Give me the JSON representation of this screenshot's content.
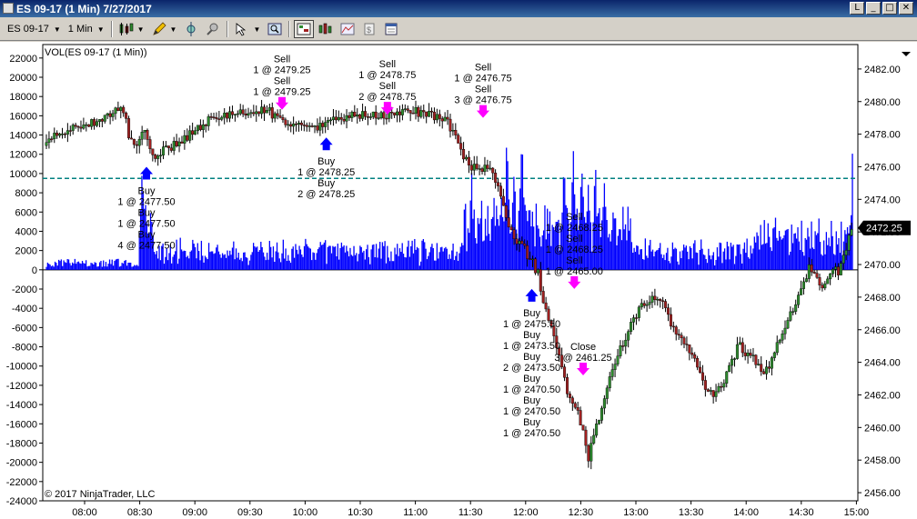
{
  "window": {
    "title": "ES 09-17 (1 Min)  7/27/2017",
    "buttons": [
      "L",
      "_",
      "□",
      "✕"
    ]
  },
  "toolbar": {
    "instrument": "ES 09-17",
    "interval": "1 Min",
    "icons": [
      "candlestick-icon",
      "pencil-icon",
      "crosshair-icon",
      "magnet-icon",
      "pointer-icon",
      "zoom-icon",
      "data-box-icon",
      "bar-style-icon",
      "line-chart-icon",
      "properties-icon",
      "window-icon"
    ]
  },
  "chart": {
    "indicator_label": "VOL(ES 09-17 (1 Min))",
    "copyright": "© 2017 NinjaTrader, LLC",
    "last_price_label": "2472.25",
    "colors": {
      "volume": "#0000ff",
      "up": "#2e8b2e",
      "down": "#a02020",
      "sell": "#ff00ff",
      "buy": "#0000ff",
      "zero_line": "#000000",
      "level_line": "#008080"
    }
  },
  "chart_data": {
    "type": "candlestick",
    "x_ticks": [
      "08:00",
      "08:30",
      "09:00",
      "09:30",
      "10:00",
      "10:30",
      "11:00",
      "11:30",
      "12:00",
      "12:30",
      "13:00",
      "13:30",
      "14:00",
      "14:30",
      "15:00"
    ],
    "price_ticks": [
      "2482.00",
      "2480.00",
      "2478.00",
      "2476.00",
      "2474.00",
      "2472.00",
      "2470.00",
      "2468.00",
      "2466.00",
      "2464.00",
      "2462.00",
      "2460.00",
      "2458.00",
      "2456.00"
    ],
    "volume_ticks": [
      "22000",
      "20000",
      "18000",
      "16000",
      "14000",
      "12000",
      "10000",
      "8000",
      "6000",
      "4000",
      "2000",
      "0",
      "-2000",
      "-4000",
      "-6000",
      "-8000",
      "-10000",
      "-12000",
      "-14000",
      "-16000",
      "-18000",
      "-20000",
      "-22000",
      "-24000"
    ],
    "price_range": [
      2455.5,
      2483.5
    ],
    "volume_range": [
      -24000,
      23400
    ],
    "price_path": [
      [
        0,
        2477.3
      ],
      [
        8,
        2477.9
      ],
      [
        20,
        2478.1
      ],
      [
        40,
        2478.5
      ],
      [
        60,
        2478.9
      ],
      [
        80,
        2479.4
      ],
      [
        88,
        2479.6
      ],
      [
        92,
        2477.8
      ],
      [
        100,
        2477.5
      ],
      [
        112,
        2478.0
      ],
      [
        118,
        2476.6
      ],
      [
        125,
        2476.4
      ],
      [
        132,
        2477.0
      ],
      [
        150,
        2477.5
      ],
      [
        170,
        2478.4
      ],
      [
        190,
        2479.0
      ],
      [
        220,
        2479.3
      ],
      [
        250,
        2479.4
      ],
      [
        265,
        2479.0
      ],
      [
        275,
        2478.6
      ],
      [
        290,
        2478.3
      ],
      [
        310,
        2478.5
      ],
      [
        330,
        2478.9
      ],
      [
        350,
        2479.2
      ],
      [
        370,
        2479.1
      ],
      [
        395,
        2479.2
      ],
      [
        410,
        2479.4
      ],
      [
        425,
        2479.3
      ],
      [
        440,
        2479.1
      ],
      [
        455,
        2478.6
      ],
      [
        465,
        2477.4
      ],
      [
        478,
        2476.0
      ],
      [
        488,
        2475.8
      ],
      [
        500,
        2476.0
      ],
      [
        505,
        2475.6
      ],
      [
        512,
        2474.2
      ],
      [
        520,
        2472.8
      ],
      [
        530,
        2471.6
      ],
      [
        545,
        2470.5
      ],
      [
        555,
        2469.4
      ],
      [
        560,
        2467.9
      ],
      [
        572,
        2466.0
      ],
      [
        580,
        2464.0
      ],
      [
        588,
        2462.2
      ],
      [
        600,
        2460.8
      ],
      [
        608,
        2459.5
      ],
      [
        612,
        2458.2
      ],
      [
        620,
        2459.7
      ],
      [
        630,
        2462.0
      ],
      [
        645,
        2464.4
      ],
      [
        660,
        2466.2
      ],
      [
        672,
        2467.4
      ],
      [
        684,
        2467.9
      ],
      [
        696,
        2467.6
      ],
      [
        705,
        2466.2
      ],
      [
        715,
        2465.5
      ],
      [
        728,
        2464.4
      ],
      [
        738,
        2463.4
      ],
      [
        748,
        2462.0
      ],
      [
        762,
        2462.4
      ],
      [
        772,
        2464.0
      ],
      [
        782,
        2465.0
      ],
      [
        795,
        2464.4
      ],
      [
        808,
        2463.4
      ],
      [
        818,
        2464.0
      ],
      [
        832,
        2466.0
      ],
      [
        845,
        2467.6
      ],
      [
        855,
        2469.0
      ],
      [
        862,
        2470.0
      ],
      [
        870,
        2469.2
      ],
      [
        878,
        2468.6
      ],
      [
        888,
        2470.0
      ],
      [
        895,
        2469.3
      ],
      [
        902,
        2471.0
      ],
      [
        910,
        2472.25
      ]
    ],
    "volume_spikes": [
      [
        108,
        12000
      ],
      [
        112,
        9500
      ],
      [
        118,
        8000
      ],
      [
        293,
        4200
      ],
      [
        320,
        3000
      ],
      [
        375,
        2200
      ],
      [
        468,
        2800
      ],
      [
        480,
        10500
      ],
      [
        490,
        7000
      ],
      [
        505,
        8500
      ],
      [
        513,
        9000
      ],
      [
        520,
        16000
      ],
      [
        528,
        12000
      ],
      [
        537,
        15500
      ],
      [
        545,
        9500
      ],
      [
        555,
        6500
      ],
      [
        563,
        4500
      ],
      [
        575,
        6000
      ],
      [
        585,
        13500
      ],
      [
        595,
        13000
      ],
      [
        605,
        14000
      ],
      [
        612,
        11000
      ],
      [
        620,
        11500
      ],
      [
        630,
        9500
      ],
      [
        640,
        6500
      ],
      [
        650,
        3500
      ],
      [
        720,
        3500
      ],
      [
        800,
        4200
      ],
      [
        860,
        5200
      ],
      [
        870,
        3500
      ],
      [
        905,
        4800
      ],
      [
        912,
        22800
      ]
    ],
    "level_line": 9500,
    "price_flag": 2472.25,
    "annotations": [
      {
        "kind": "sell",
        "lines": [
          "Sell",
          "1 @ 2479.25",
          "Sell",
          "1 @ 2479.25"
        ],
        "t": 266,
        "price": 2479.5
      },
      {
        "kind": "sell",
        "lines": [
          "Sell",
          "1 @ 2478.75",
          "Sell",
          "2 @ 2478.75"
        ],
        "t": 385,
        "price": 2479.2
      },
      {
        "kind": "sell",
        "lines": [
          "Sell",
          "1 @ 2476.75",
          "Sell",
          "3 @ 2476.75"
        ],
        "t": 493,
        "price": 2479.0
      },
      {
        "kind": "buy",
        "lines": [
          "Buy",
          "1 @ 2477.50",
          "Buy",
          "1 @ 2477.50",
          "Buy",
          "4 @ 2477.50"
        ],
        "t": 113,
        "price": 2476.0
      },
      {
        "kind": "buy",
        "lines": [
          "Buy",
          "1 @ 2478.25",
          "Buy",
          "2 @ 2478.25"
        ],
        "t": 316,
        "price": 2477.8
      },
      {
        "kind": "buy",
        "lines": [
          "Buy",
          "1 @ 2475.50",
          "Buy",
          "1 @ 2473.50",
          "Buy",
          "2 @ 2473.50",
          "Buy",
          "1 @ 2470.50",
          "Buy",
          "1 @ 2470.50",
          "Buy",
          "1 @ 2470.50"
        ],
        "t": 548,
        "price": 2468.5
      },
      {
        "kind": "sell",
        "lines": [
          "Sell",
          "1 @ 2468.25",
          "Sell",
          "1 @ 2468.25",
          "Sell",
          "1 @ 2465.00"
        ],
        "t": 596,
        "price": 2468.5
      },
      {
        "kind": "close",
        "lines": [
          "Close",
          "3 @ 2461.25"
        ],
        "t": 606,
        "price": 2463.2
      }
    ]
  }
}
